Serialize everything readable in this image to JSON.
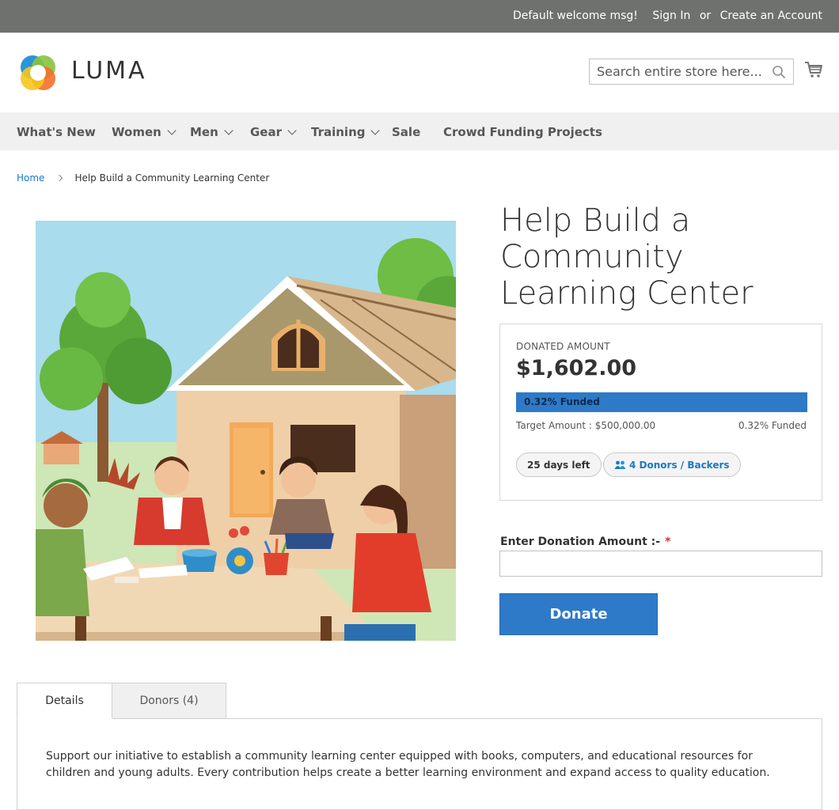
{
  "topbar": {
    "welcome": "Default welcome msg!",
    "sign_in": "Sign In",
    "or": "or",
    "create_account": "Create an Account"
  },
  "header": {
    "logo_text": "LUMA",
    "search_placeholder": "Search entire store here...",
    "icons": [
      "luma-logo",
      "search-icon",
      "cart-icon"
    ]
  },
  "nav": {
    "items": [
      {
        "label": "What's New",
        "dropdown": false
      },
      {
        "label": "Women",
        "dropdown": true
      },
      {
        "label": "Men",
        "dropdown": true
      },
      {
        "label": "Gear",
        "dropdown": true
      },
      {
        "label": "Training",
        "dropdown": true
      },
      {
        "label": "Sale",
        "dropdown": false
      },
      {
        "label": "Crowd Funding Projects",
        "dropdown": false
      }
    ]
  },
  "breadcrumb": {
    "home": "Home",
    "current": "Help Build a Community Learning Center"
  },
  "product": {
    "title": "Help Build a Community Learning Center",
    "donated_label": "DONATED AMOUNT",
    "donated_amount": "$1,602.00",
    "funded_fraction": 0.0032,
    "progress_label": "0.32% Funded",
    "target_amount": "Target Amount : $500,000.00",
    "funded_text": "0.32% Funded",
    "days_left": "25 days left",
    "donors": "4 Donors / Backers"
  },
  "donation": {
    "label": "Enter Donation Amount :-",
    "required_mark": "*",
    "input_value": "",
    "button_label": "Donate"
  },
  "tabs": {
    "details_label": "Details",
    "donors_label": "Donors (4)",
    "active": "Details",
    "details_text": "Support our initiative to establish a community learning center equipped with books, computers, and educational resources for children and young adults. Every contribution helps create a better learning environment and expand access to quality education."
  },
  "colors": {
    "topbar_bg": "#6e716e",
    "nav_bg": "#f0f0f0",
    "accent_blue": "#2e7ac8",
    "link_blue": "#1979c3",
    "required_red": "#e02b27"
  }
}
